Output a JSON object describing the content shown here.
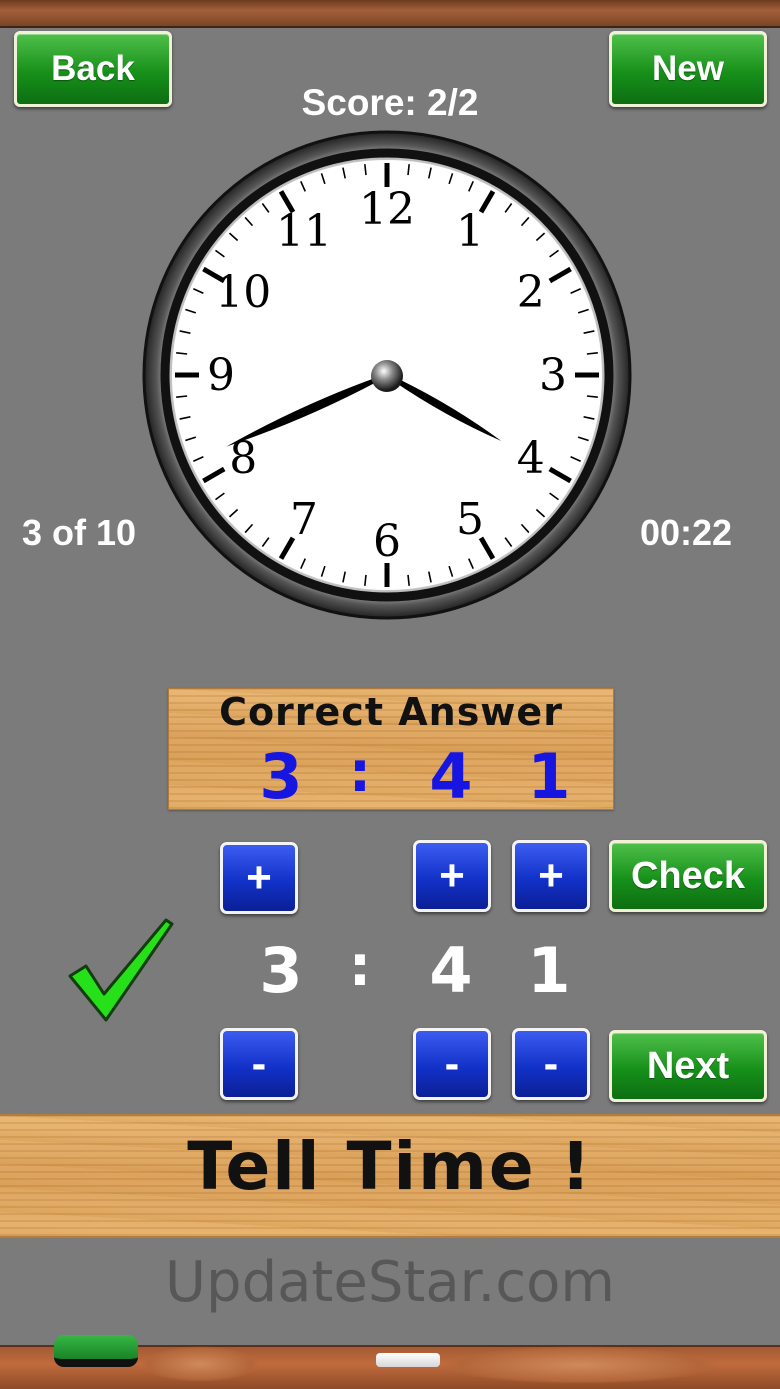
{
  "header": {
    "back_label": "Back",
    "new_label": "New",
    "score": "Score: 2/2"
  },
  "progress": "3 of 10",
  "timer": "00:22",
  "clock": {
    "numbers": [
      "12",
      "1",
      "2",
      "3",
      "4",
      "5",
      "6",
      "7",
      "8",
      "9",
      "10",
      "11"
    ],
    "hour_hand_target": 4,
    "minute_hand_target": 41
  },
  "correct_answer": {
    "title": "Correct Answer",
    "hour": "3",
    "separator": ":",
    "tens": "4",
    "ones": "1"
  },
  "answer": {
    "hour": "3",
    "separator": ":",
    "tens": "4",
    "ones": "1",
    "plus": "+",
    "minus": "-"
  },
  "buttons": {
    "check_label": "Check",
    "next_label": "Next"
  },
  "banner": {
    "title": "Tell Time !"
  },
  "watermark": "UpdateStar.com",
  "colors": {
    "green": "#17901a",
    "blue": "#1231c8",
    "answer_blue": "#1616e0",
    "board": "#7b7b7c",
    "check": "#26e01a"
  }
}
